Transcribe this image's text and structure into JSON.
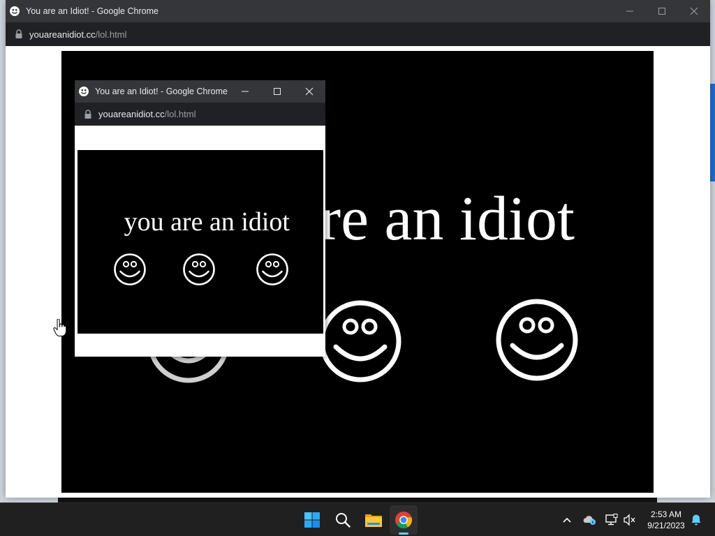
{
  "main_window": {
    "title": "You are an Idiot! - Google Chrome",
    "url_domain": "youareanidiot.cc",
    "url_path": "/lol.html",
    "page_text": "you are an idiot"
  },
  "popup_window": {
    "title": "You are an Idiot! - Google Chrome",
    "url_domain": "youareanidiot.cc",
    "url_path": "/lol.html",
    "page_text": "you are an idiot"
  },
  "taskbar": {
    "apps": [
      {
        "name": "start",
        "icon": "windows-logo-icon"
      },
      {
        "name": "search",
        "icon": "search-icon"
      },
      {
        "name": "file-explorer",
        "icon": "folder-icon"
      },
      {
        "name": "chrome",
        "icon": "chrome-icon",
        "active": true
      }
    ],
    "tray": [
      "chevron-up-icon",
      "onedrive-icon",
      "network-icon",
      "volume-muted-icon"
    ],
    "time": "2:53 AM",
    "date": "9/21/2023",
    "notification_icon": "bell-icon"
  },
  "colors": {
    "titlebar": "#35363a",
    "urlbar": "#202124",
    "page_bg": "#000000",
    "taskbar": "#202020",
    "accent": "#60cdff"
  }
}
